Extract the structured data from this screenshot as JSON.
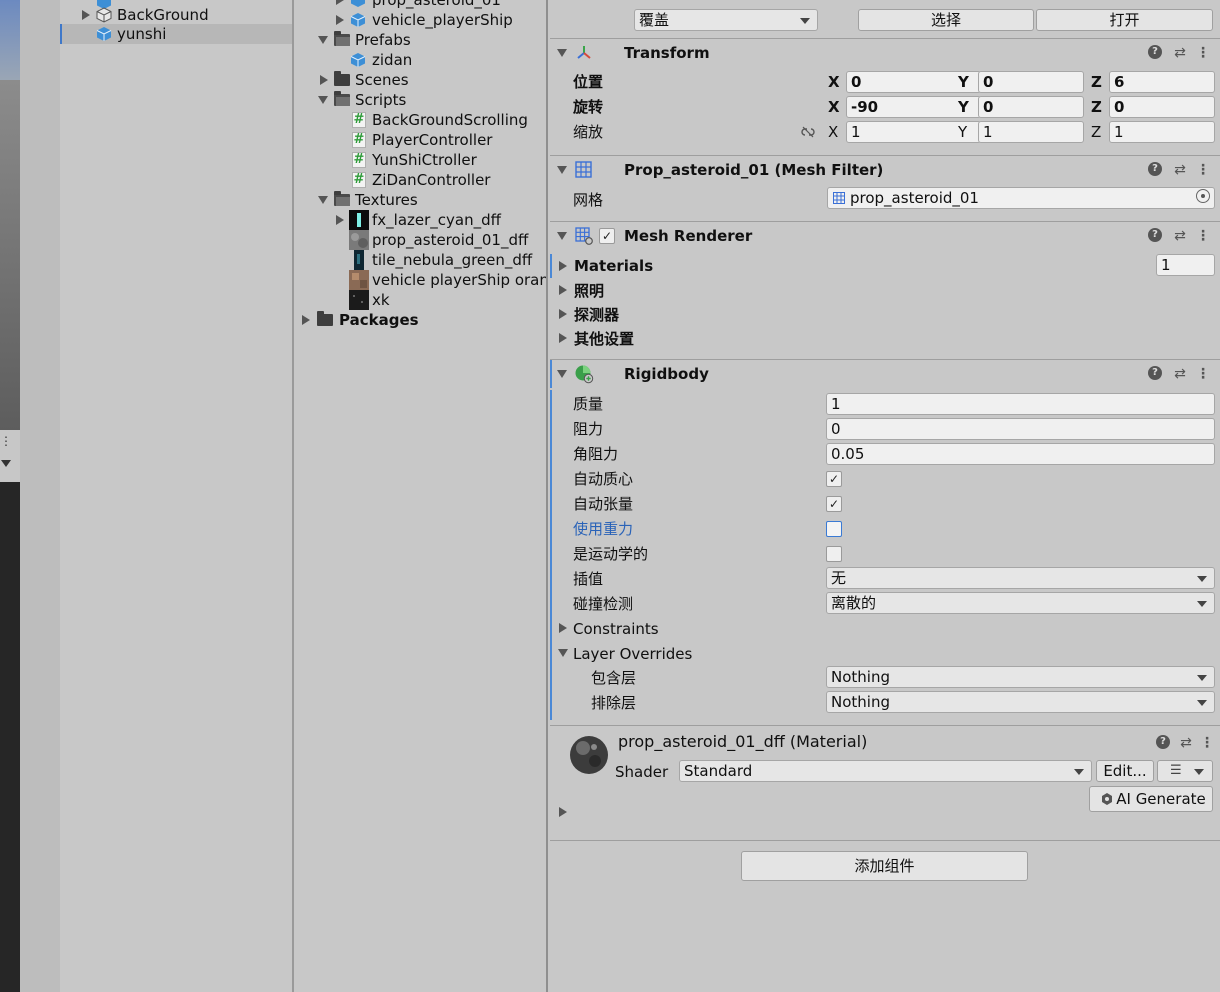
{
  "hierarchy": {
    "items": [
      {
        "label": "BackGround"
      },
      {
        "label": "yunshi"
      }
    ]
  },
  "project": {
    "items": [
      {
        "label": "prop_asteroid_01"
      },
      {
        "label": "vehicle_playerShip"
      },
      {
        "label": "Prefabs"
      },
      {
        "label": "zidan"
      },
      {
        "label": "Scenes"
      },
      {
        "label": "Scripts"
      },
      {
        "label": "BackGroundScrolling"
      },
      {
        "label": "PlayerController"
      },
      {
        "label": "YunShiCtroller"
      },
      {
        "label": "ZiDanController"
      },
      {
        "label": "Textures"
      },
      {
        "label": "fx_lazer_cyan_dff"
      },
      {
        "label": "prop_asteroid_01_dff"
      },
      {
        "label": "tile_nebula_green_dff"
      },
      {
        "label": "vehicle playerShip oran"
      },
      {
        "label": "xk"
      },
      {
        "label": "Packages"
      }
    ]
  },
  "inspector": {
    "top": {
      "override_value": "覆盖",
      "select_label": "选择",
      "open_label": "打开"
    },
    "transform": {
      "title": "Transform",
      "position_label": "位置",
      "rotation_label": "旋转",
      "scale_label": "缩放",
      "axis_x": "X",
      "axis_y": "Y",
      "axis_z": "Z",
      "position": {
        "x": "0",
        "y": "0",
        "z": "6"
      },
      "rotation": {
        "x": "-90",
        "y": "0",
        "z": "0"
      },
      "scale": {
        "x": "1",
        "y": "1",
        "z": "1"
      }
    },
    "mesh_filter": {
      "title": "Prop_asteroid_01 (Mesh Filter)",
      "mesh_label": "网格",
      "mesh_value": "prop_asteroid_01"
    },
    "mesh_renderer": {
      "title": "Mesh Renderer",
      "materials_label": "Materials",
      "materials_count": "1",
      "lighting_label": "照明",
      "probes_label": "探测器",
      "other_label": "其他设置"
    },
    "rigidbody": {
      "title": "Rigidbody",
      "mass_label": "质量",
      "mass": "1",
      "drag_label": "阻力",
      "drag": "0",
      "angular_drag_label": "角阻力",
      "angular_drag": "0.05",
      "auto_com_label": "自动质心",
      "auto_com": "✓",
      "auto_tensor_label": "自动张量",
      "auto_tensor": "✓",
      "use_gravity_label": "使用重力",
      "kinematic_label": "是运动学的",
      "interpolate_label": "插值",
      "interpolate": "无",
      "collision_label": "碰撞检测",
      "collision": "离散的",
      "constraints_label": "Constraints",
      "layer_overrides_label": "Layer Overrides",
      "include_label": "包含层",
      "include": "Nothing",
      "exclude_label": "排除层",
      "exclude": "Nothing"
    },
    "material": {
      "title": "prop_asteroid_01_dff (Material)",
      "shader_label": "Shader",
      "shader": "Standard",
      "edit_label": "Edit...",
      "ai_label": "AI Generate"
    },
    "add_component_label": "添加组件"
  },
  "colors": {
    "selection_accent": "#3f78c9",
    "script_green": "#2f9c3a"
  }
}
